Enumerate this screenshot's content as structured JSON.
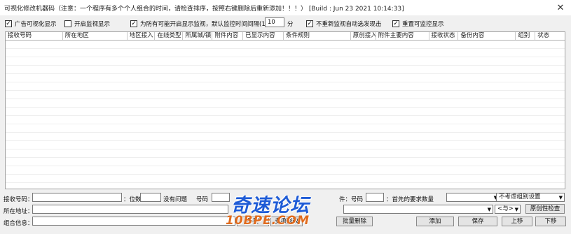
{
  "window": {
    "title": "可视化修改机器码（注意：一个程序有多个个人组合的时间，请检查排序，按照右键删除后重新添加！！！） [Build : Jun 23 2021 10:14:33]",
    "close_glyph": "✕"
  },
  "options": {
    "opt1": "广告可视化显示",
    "opt2": "开启监视显示",
    "opt3": "为防有可能开启显示监视，默认监控时间间隔(1-15)",
    "interval_value": "10",
    "interval_unit": "分",
    "opt4": "不重新监视自动选发现击",
    "opt5": "重置可监控显示"
  },
  "table": {
    "columns": [
      "接收号码",
      "所在地区",
      "地区接入",
      "在线类型",
      "所属城/镇",
      "附件内容",
      "已显示内容",
      "条件规则",
      "原创接入",
      "附件主要内容",
      "接收状态",
      "备份内容",
      "组别",
      "状态"
    ]
  },
  "form": {
    "row1": {
      "label1": "接收号码：",
      "label2": "：位数",
      "label3": "没有问题",
      "label4": "号码",
      "label5": "件：号码",
      "label6": "：首先的要求数量",
      "select1": "",
      "select2": "不考虑组别设置"
    },
    "row2": {
      "label1": "所在地址：",
      "select1": "",
      "select2": "<与>",
      "button": "原创性检查"
    },
    "row3": {
      "label1": "组合信息：",
      "btn1": "不要",
      "btn2": "多项修改",
      "btn3": "批量删除",
      "btn4": "添加",
      "btn5": "保存",
      "btn6": "上移",
      "btn7": "下移"
    }
  },
  "watermark": {
    "line1": "奇速论坛",
    "line2": "10BPE.COM"
  },
  "colors": {
    "watermark_blue": "#1e5bd6",
    "watermark_orange": "#e06a1c",
    "window_bg": "#f0f0f0"
  }
}
